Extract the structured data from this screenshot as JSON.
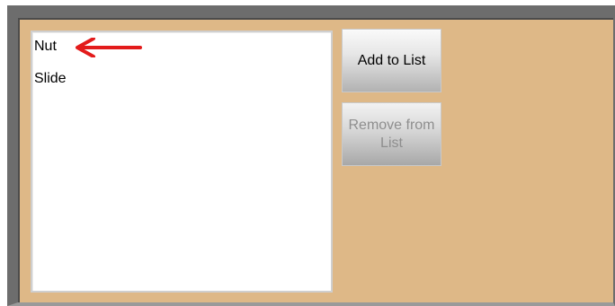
{
  "list": {
    "items": [
      "Nut",
      "Slide"
    ]
  },
  "annotation": {
    "arrow_icon": "red-left-arrow-icon",
    "arrow_color": "#e31b1b"
  },
  "buttons": {
    "add_label": "Add to List",
    "remove_label": "Remove from List",
    "remove_state": "disabled"
  },
  "colors": {
    "panel_background": "#deb887",
    "frame": "#6d6d6d",
    "listbox_background": "#ffffff"
  }
}
